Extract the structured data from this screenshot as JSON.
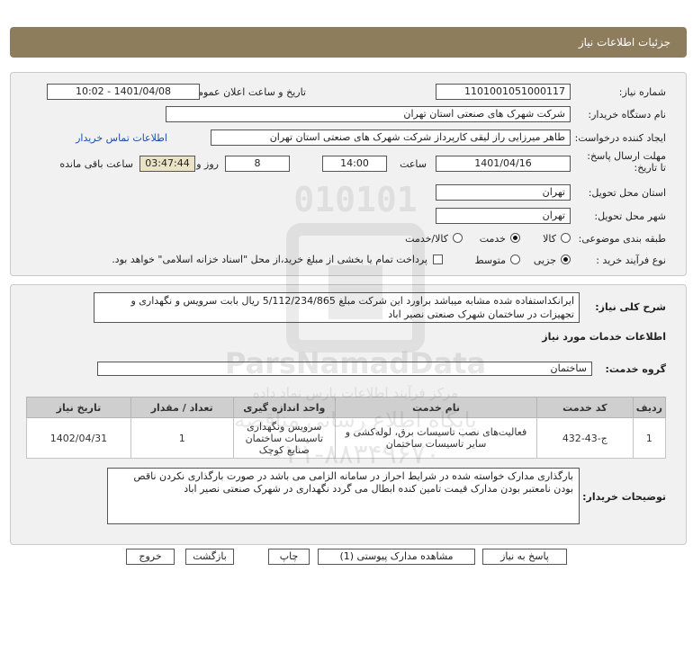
{
  "header": {
    "title": "جزئیات اطلاعات نیاز"
  },
  "form": {
    "need_number_label": "شماره نیاز:",
    "need_number": "1101001051000117",
    "announce_label": "تاریخ و ساعت اعلان عمومی:",
    "announce_value": "1401/04/08 - 10:02",
    "buyer_org_label": "نام دستگاه خریدار:",
    "buyer_org": "شرکت شهرک های صنعتی استان تهران",
    "creator_label": "ایجاد کننده درخواست:",
    "creator": "طاهر  میرزایی راز لیقی کارپرداز شرکت شهرک های صنعتی استان تهران",
    "contact_link": "اطلاعات تماس خریدار",
    "deadline_label": "مهلت ارسال پاسخ: تا تاریخ:",
    "deadline_date": "1401/04/16",
    "time_label": "ساعت",
    "deadline_time": "14:00",
    "days_value": "8",
    "days_label": "روز و",
    "remaining_value": "03:47:44",
    "remaining_label": "ساعت باقی مانده",
    "province_label": "استان محل تحویل:",
    "province": "تهران",
    "city_label": "شهر محل تحویل:",
    "city": "تهران",
    "category_label": "طبقه بندی موضوعی:",
    "category_options": [
      "کالا",
      "خدمت",
      "کالا/خدمت"
    ],
    "category_selected": "خدمت",
    "process_label": "نوع فرآیند خرید :",
    "process_options": [
      "جزیی",
      "متوسط"
    ],
    "process_selected": "جزیی",
    "payment_note": "پرداخت تمام یا بخشی از مبلغ خرید،از محل \"اسناد خزانه اسلامی\" خواهد بود."
  },
  "details": {
    "summary_label": "شرح کلی نیاز:",
    "summary": "ایرانکداستفاده شده مشابه میباشد براورد این شرکت مبلغ 5/112/234/865 ریال بابت سرویس و نگهداری و تجهیزات در ساختمان شهرک صنعتی نصیر اباد",
    "services_title": "اطلاعات خدمات مورد نیاز",
    "service_group_label": "گروه خدمت:",
    "service_group": "ساختمان",
    "table": {
      "headers": [
        "ردیف",
        "کد خدمت",
        "نام خدمت",
        "واحد اندازه گیری",
        "تعداد / مقدار",
        "تاریخ نیاز"
      ],
      "rows": [
        [
          "1",
          "ج-43-432",
          "فعالیت‌های نصب تاسیسات برق، لوله‌کشی و سایر تاسیسات ساختمان",
          "سرویس ونگهداری تاسیسات ساختمان صنایع کوچک",
          "1",
          "1402/04/31"
        ]
      ]
    },
    "buyer_notes_label": "توضیحات خریدار:",
    "buyer_notes": "بارگذاری مدارک خواسته شده در شرایط احراز در سامانه الزامی می باشد در صورت بارگذاری نکردن ناقص بودن نامعتبر بودن مدارک قیمت تامین کنده ابطال می گردد  نگهداری در شهرک صنعتی نصیر اباد"
  },
  "buttons": {
    "reply": "پاسخ به نیاز",
    "view_docs": "مشاهده مدارک پیوستی (1)",
    "print": "چاپ",
    "back": "بازگشت",
    "exit": "خروج"
  },
  "watermark": {
    "number": "010101",
    "brand": "ParsNamadData",
    "line1": "مرکز فرآیند اطلاعات پارس نماد داده",
    "line2": "پایگاه اطلاع رسانی مناقصه",
    "phone": "۰۲۱-۸۸۳۴۹۶۷۰"
  }
}
